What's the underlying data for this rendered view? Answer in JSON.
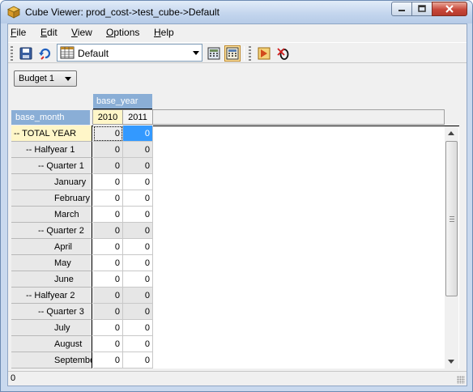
{
  "window": {
    "title": "Cube Viewer: prod_cost->test_cube->Default"
  },
  "menu": [
    {
      "label": "File",
      "mnemonic": "F",
      "rest": "ile"
    },
    {
      "label": "Edit",
      "mnemonic": "E",
      "rest": "dit"
    },
    {
      "label": "View",
      "mnemonic": "V",
      "rest": "iew"
    },
    {
      "label": "Options",
      "mnemonic": "O",
      "rest": "ptions"
    },
    {
      "label": "Help",
      "mnemonic": "H",
      "rest": "elp"
    }
  ],
  "toolbar": {
    "view_selector": {
      "value": "Default"
    },
    "icons": [
      "save-icon",
      "recalculate-icon",
      "view-icon",
      "calculator-icon",
      "automatic-recalc-icon",
      "run-icon",
      "zero-suppression-icon"
    ]
  },
  "filter": {
    "value": "Budget 1"
  },
  "grid": {
    "column_dimension": "base_year",
    "row_dimension": "base_month",
    "columns": [
      "2010",
      "2011"
    ],
    "rows": [
      {
        "label": "-- TOTAL YEAR",
        "indent": 0,
        "consolidated": true,
        "values": [
          "0",
          "0"
        ]
      },
      {
        "label": "-- Halfyear 1",
        "indent": 1,
        "consolidated": true,
        "values": [
          "0",
          "0"
        ]
      },
      {
        "label": "-- Quarter 1",
        "indent": 2,
        "consolidated": true,
        "values": [
          "0",
          "0"
        ]
      },
      {
        "label": "January",
        "indent": 3,
        "consolidated": false,
        "values": [
          "0",
          "0"
        ]
      },
      {
        "label": "February",
        "indent": 3,
        "consolidated": false,
        "values": [
          "0",
          "0"
        ]
      },
      {
        "label": "March",
        "indent": 3,
        "consolidated": false,
        "values": [
          "0",
          "0"
        ]
      },
      {
        "label": "-- Quarter 2",
        "indent": 2,
        "consolidated": true,
        "values": [
          "0",
          "0"
        ]
      },
      {
        "label": "April",
        "indent": 3,
        "consolidated": false,
        "values": [
          "0",
          "0"
        ]
      },
      {
        "label": "May",
        "indent": 3,
        "consolidated": false,
        "values": [
          "0",
          "0"
        ]
      },
      {
        "label": "June",
        "indent": 3,
        "consolidated": false,
        "values": [
          "0",
          "0"
        ]
      },
      {
        "label": "-- Halfyear 2",
        "indent": 1,
        "consolidated": true,
        "values": [
          "0",
          "0"
        ]
      },
      {
        "label": "-- Quarter 3",
        "indent": 2,
        "consolidated": true,
        "values": [
          "0",
          "0"
        ]
      },
      {
        "label": "July",
        "indent": 3,
        "consolidated": false,
        "values": [
          "0",
          "0"
        ]
      },
      {
        "label": "August",
        "indent": 3,
        "consolidated": false,
        "values": [
          "0",
          "0"
        ]
      },
      {
        "label": "September",
        "indent": 3,
        "consolidated": false,
        "values": [
          "0",
          "0"
        ]
      }
    ]
  },
  "status": {
    "text": "0"
  },
  "colors": {
    "dimension_header": "#8aaed6",
    "selected_member": "#fff6c8",
    "consolidated_cell": "#e6e6e6",
    "selected_cell": "#3399ff"
  }
}
